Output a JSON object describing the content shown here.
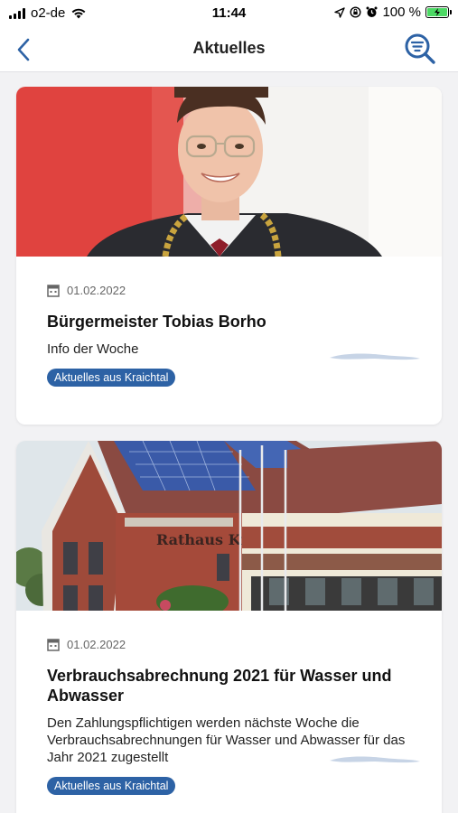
{
  "status_bar": {
    "carrier": "o2-de",
    "time": "11:44",
    "battery": "100 %"
  },
  "nav": {
    "title": "Aktuelles",
    "back_icon": "chevron-left-icon",
    "search_icon": "search-filter-icon"
  },
  "colors": {
    "accent": "#2d62a5",
    "tag_bg": "#2d62a5",
    "background": "#f2f2f4"
  },
  "news": [
    {
      "date": "01.02.2022",
      "title": "Bürgermeister Tobias Borho",
      "text": "Info der Woche",
      "tag": "Aktuelles aus Kraichtal"
    },
    {
      "date": "01.02.2022",
      "title": "Verbrauchsabrechnung 2021 für Wasser und Abwasser",
      "text": "Den Zahlungspflichtigen werden nächste Woche die Verbrauchsabrechnungen für Wasser und Abwasser für das Jahr 2021 zugestellt",
      "tag": "Aktuelles aus Kraichtal",
      "image_sign": "Rathaus Kraichtal"
    }
  ]
}
